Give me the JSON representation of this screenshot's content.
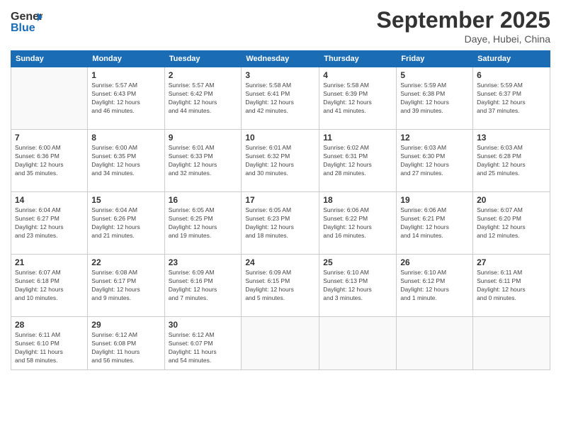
{
  "logo": {
    "line1": "General",
    "line2": "Blue"
  },
  "title": "September 2025",
  "location": "Daye, Hubei, China",
  "days_of_week": [
    "Sunday",
    "Monday",
    "Tuesday",
    "Wednesday",
    "Thursday",
    "Friday",
    "Saturday"
  ],
  "weeks": [
    [
      {
        "day": "",
        "info": ""
      },
      {
        "day": "1",
        "info": "Sunrise: 5:57 AM\nSunset: 6:43 PM\nDaylight: 12 hours\nand 46 minutes."
      },
      {
        "day": "2",
        "info": "Sunrise: 5:57 AM\nSunset: 6:42 PM\nDaylight: 12 hours\nand 44 minutes."
      },
      {
        "day": "3",
        "info": "Sunrise: 5:58 AM\nSunset: 6:41 PM\nDaylight: 12 hours\nand 42 minutes."
      },
      {
        "day": "4",
        "info": "Sunrise: 5:58 AM\nSunset: 6:39 PM\nDaylight: 12 hours\nand 41 minutes."
      },
      {
        "day": "5",
        "info": "Sunrise: 5:59 AM\nSunset: 6:38 PM\nDaylight: 12 hours\nand 39 minutes."
      },
      {
        "day": "6",
        "info": "Sunrise: 5:59 AM\nSunset: 6:37 PM\nDaylight: 12 hours\nand 37 minutes."
      }
    ],
    [
      {
        "day": "7",
        "info": "Sunrise: 6:00 AM\nSunset: 6:36 PM\nDaylight: 12 hours\nand 35 minutes."
      },
      {
        "day": "8",
        "info": "Sunrise: 6:00 AM\nSunset: 6:35 PM\nDaylight: 12 hours\nand 34 minutes."
      },
      {
        "day": "9",
        "info": "Sunrise: 6:01 AM\nSunset: 6:33 PM\nDaylight: 12 hours\nand 32 minutes."
      },
      {
        "day": "10",
        "info": "Sunrise: 6:01 AM\nSunset: 6:32 PM\nDaylight: 12 hours\nand 30 minutes."
      },
      {
        "day": "11",
        "info": "Sunrise: 6:02 AM\nSunset: 6:31 PM\nDaylight: 12 hours\nand 28 minutes."
      },
      {
        "day": "12",
        "info": "Sunrise: 6:03 AM\nSunset: 6:30 PM\nDaylight: 12 hours\nand 27 minutes."
      },
      {
        "day": "13",
        "info": "Sunrise: 6:03 AM\nSunset: 6:28 PM\nDaylight: 12 hours\nand 25 minutes."
      }
    ],
    [
      {
        "day": "14",
        "info": "Sunrise: 6:04 AM\nSunset: 6:27 PM\nDaylight: 12 hours\nand 23 minutes."
      },
      {
        "day": "15",
        "info": "Sunrise: 6:04 AM\nSunset: 6:26 PM\nDaylight: 12 hours\nand 21 minutes."
      },
      {
        "day": "16",
        "info": "Sunrise: 6:05 AM\nSunset: 6:25 PM\nDaylight: 12 hours\nand 19 minutes."
      },
      {
        "day": "17",
        "info": "Sunrise: 6:05 AM\nSunset: 6:23 PM\nDaylight: 12 hours\nand 18 minutes."
      },
      {
        "day": "18",
        "info": "Sunrise: 6:06 AM\nSunset: 6:22 PM\nDaylight: 12 hours\nand 16 minutes."
      },
      {
        "day": "19",
        "info": "Sunrise: 6:06 AM\nSunset: 6:21 PM\nDaylight: 12 hours\nand 14 minutes."
      },
      {
        "day": "20",
        "info": "Sunrise: 6:07 AM\nSunset: 6:20 PM\nDaylight: 12 hours\nand 12 minutes."
      }
    ],
    [
      {
        "day": "21",
        "info": "Sunrise: 6:07 AM\nSunset: 6:18 PM\nDaylight: 12 hours\nand 10 minutes."
      },
      {
        "day": "22",
        "info": "Sunrise: 6:08 AM\nSunset: 6:17 PM\nDaylight: 12 hours\nand 9 minutes."
      },
      {
        "day": "23",
        "info": "Sunrise: 6:09 AM\nSunset: 6:16 PM\nDaylight: 12 hours\nand 7 minutes."
      },
      {
        "day": "24",
        "info": "Sunrise: 6:09 AM\nSunset: 6:15 PM\nDaylight: 12 hours\nand 5 minutes."
      },
      {
        "day": "25",
        "info": "Sunrise: 6:10 AM\nSunset: 6:13 PM\nDaylight: 12 hours\nand 3 minutes."
      },
      {
        "day": "26",
        "info": "Sunrise: 6:10 AM\nSunset: 6:12 PM\nDaylight: 12 hours\nand 1 minute."
      },
      {
        "day": "27",
        "info": "Sunrise: 6:11 AM\nSunset: 6:11 PM\nDaylight: 12 hours\nand 0 minutes."
      }
    ],
    [
      {
        "day": "28",
        "info": "Sunrise: 6:11 AM\nSunset: 6:10 PM\nDaylight: 11 hours\nand 58 minutes."
      },
      {
        "day": "29",
        "info": "Sunrise: 6:12 AM\nSunset: 6:08 PM\nDaylight: 11 hours\nand 56 minutes."
      },
      {
        "day": "30",
        "info": "Sunrise: 6:12 AM\nSunset: 6:07 PM\nDaylight: 11 hours\nand 54 minutes."
      },
      {
        "day": "",
        "info": ""
      },
      {
        "day": "",
        "info": ""
      },
      {
        "day": "",
        "info": ""
      },
      {
        "day": "",
        "info": ""
      }
    ]
  ]
}
